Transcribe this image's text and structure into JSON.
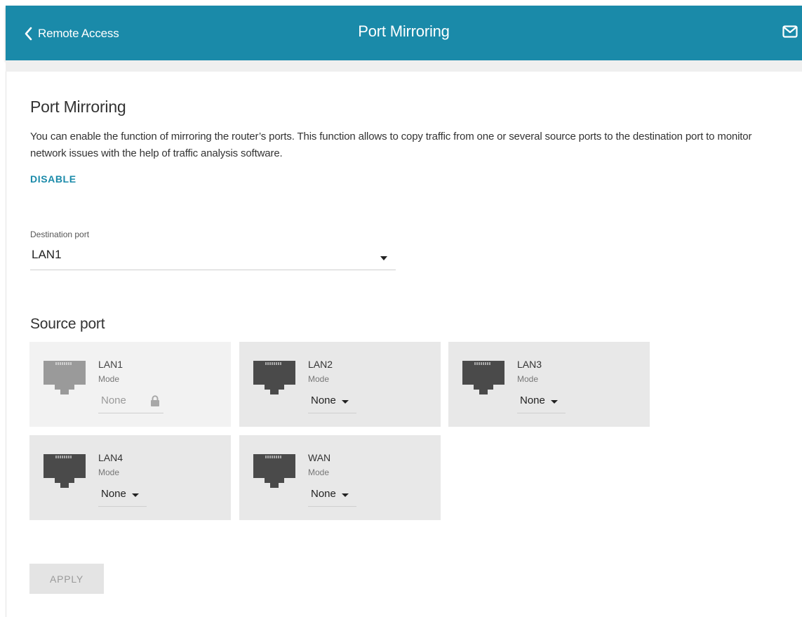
{
  "header": {
    "back_label": "Remote Access",
    "title": "Port Mirroring",
    "back_icon": "chevron-left-icon",
    "mail_icon": "mail-icon",
    "color": "#1a8aa9"
  },
  "main": {
    "title": "Port Mirroring",
    "description": "You can enable the function of mirroring the router’s ports. This function allows to copy traffic from one or several source ports to the destination port to monitor network issues with the help of traffic analysis software.",
    "disable_label": "DISABLE",
    "destination": {
      "label": "Destination port",
      "value": "LAN1"
    },
    "source_title": "Source port",
    "ports": [
      {
        "name": "LAN1",
        "mode_label": "Mode",
        "mode": "None",
        "locked": true
      },
      {
        "name": "LAN2",
        "mode_label": "Mode",
        "mode": "None",
        "locked": false
      },
      {
        "name": "LAN3",
        "mode_label": "Mode",
        "mode": "None",
        "locked": false
      },
      {
        "name": "LAN4",
        "mode_label": "Mode",
        "mode": "None",
        "locked": false
      },
      {
        "name": "WAN",
        "mode_label": "Mode",
        "mode": "None",
        "locked": false
      }
    ],
    "apply_label": "APPLY"
  }
}
